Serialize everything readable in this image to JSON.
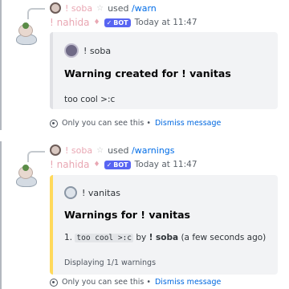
{
  "messages": [
    {
      "reply": {
        "faded_prefix": "! soba",
        "star": "☆",
        "text": "used",
        "command": "/warn"
      },
      "author": {
        "name": "! nahida",
        "gem": "♦",
        "badge": "BOT",
        "timestamp": "Today at 11:47"
      },
      "embed": {
        "author_name": "! soba",
        "title": "Warning created for ! vanitas",
        "description": "too cool >:c"
      },
      "ephemeral": {
        "text": "Only you can see this •",
        "dismiss": "Dismiss message"
      }
    },
    {
      "reply": {
        "faded_prefix": "! soba",
        "star": "☆",
        "text": "used",
        "command": "/warnings"
      },
      "author": {
        "name": "! nahida",
        "gem": "♦",
        "badge": "BOT",
        "timestamp": "Today at 11:47"
      },
      "embed": {
        "author_name": "! vanitas",
        "title": "Warnings for ! vanitas",
        "item_number": "1.",
        "item_code": "too cool >:c",
        "item_by": "by",
        "item_user": "! soba",
        "item_time": "(a few seconds ago)",
        "footer": "Displaying 1/1 warnings"
      },
      "ephemeral": {
        "text": "Only you can see this •",
        "dismiss": "Dismiss message"
      }
    }
  ],
  "colors": {
    "accent_link": "#0068e0",
    "bot_badge": "#5865f2",
    "embed_bar_yellow": "#ffd95b"
  }
}
